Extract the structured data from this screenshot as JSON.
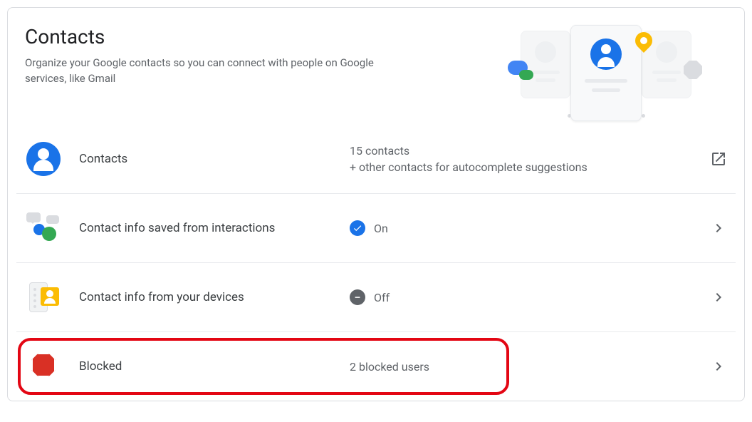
{
  "header": {
    "title": "Contacts",
    "subtitle": "Organize your Google contacts so you can connect with people on Google services, like Gmail"
  },
  "rows": {
    "contacts": {
      "label": "Contacts",
      "value_line1": "15 contacts",
      "value_line2": "+ other contacts for autocomplete suggestions"
    },
    "interactions": {
      "label": "Contact info saved from interactions",
      "status": "On"
    },
    "devices": {
      "label": "Contact info from your devices",
      "status": "Off"
    },
    "blocked": {
      "label": "Blocked",
      "value": "2 blocked users"
    }
  }
}
